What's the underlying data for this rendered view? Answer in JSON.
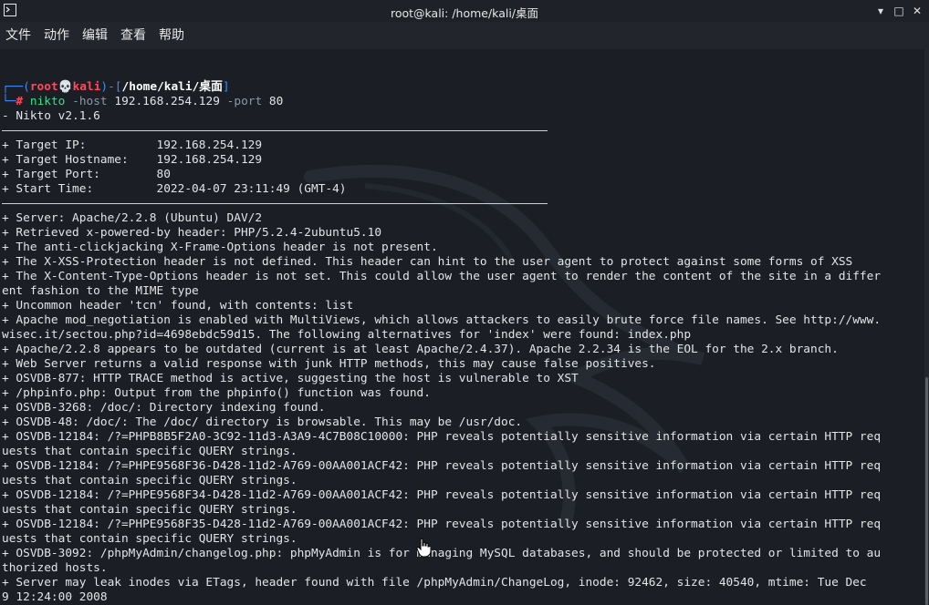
{
  "window": {
    "title": "root@kali: /home/kali/桌面",
    "minimize_glyph": "▾",
    "maximize_glyph": "□",
    "close_glyph": "✕"
  },
  "menu": [
    "文件",
    "动作",
    "编辑",
    "查看",
    "帮助"
  ],
  "prompt": {
    "open_deco": "┌──(",
    "user": "root",
    "skull": "💀",
    "host": "kali",
    "mid_deco": ")-[",
    "path": "/home/kali/桌面",
    "close_deco": "]",
    "second_deco": "└─",
    "hash": "#",
    "cmd": "nikto",
    "flag_host": "-host",
    "ip": "192.168.254.129",
    "flag_port": "-port",
    "port": "80"
  },
  "output": [
    "- Nikto v2.1.6",
    "+ Target IP:          192.168.254.129",
    "+ Target Hostname:    192.168.254.129",
    "+ Target Port:        80",
    "+ Start Time:         2022-04-07 23:11:49 (GMT-4)",
    "+ Server: Apache/2.2.8 (Ubuntu) DAV/2",
    "+ Retrieved x-powered-by header: PHP/5.2.4-2ubuntu5.10",
    "+ The anti-clickjacking X-Frame-Options header is not present.",
    "+ The X-XSS-Protection header is not defined. This header can hint to the user agent to protect against some forms of XSS",
    "+ The X-Content-Type-Options header is not set. This could allow the user agent to render the content of the site in a differ",
    "ent fashion to the MIME type",
    "+ Uncommon header 'tcn' found, with contents: list",
    "+ Apache mod_negotiation is enabled with MultiViews, which allows attackers to easily brute force file names. See http://www.",
    "wisec.it/sectou.php?id=4698ebdc59d15. The following alternatives for 'index' were found: index.php",
    "+ Apache/2.2.8 appears to be outdated (current is at least Apache/2.4.37). Apache 2.2.34 is the EOL for the 2.x branch.",
    "+ Web Server returns a valid response with junk HTTP methods, this may cause false positives.",
    "+ OSVDB-877: HTTP TRACE method is active, suggesting the host is vulnerable to XST",
    "+ /phpinfo.php: Output from the phpinfo() function was found.",
    "+ OSVDB-3268: /doc/: Directory indexing found.",
    "+ OSVDB-48: /doc/: The /doc/ directory is browsable. This may be /usr/doc.",
    "+ OSVDB-12184: /?=PHPB8B5F2A0-3C92-11d3-A3A9-4C7B08C10000: PHP reveals potentially sensitive information via certain HTTP req",
    "uests that contain specific QUERY strings.",
    "+ OSVDB-12184: /?=PHPE9568F36-D428-11d2-A769-00AA001ACF42: PHP reveals potentially sensitive information via certain HTTP req",
    "uests that contain specific QUERY strings.",
    "+ OSVDB-12184: /?=PHPE9568F34-D428-11d2-A769-00AA001ACF42: PHP reveals potentially sensitive information via certain HTTP req",
    "uests that contain specific QUERY strings.",
    "+ OSVDB-12184: /?=PHPE9568F35-D428-11d2-A769-00AA001ACF42: PHP reveals potentially sensitive information via certain HTTP req",
    "uests that contain specific QUERY strings.",
    "+ OSVDB-3092: /phpMyAdmin/changelog.php: phpMyAdmin is for managing MySQL databases, and should be protected or limited to au",
    "thorized hosts.",
    "+ Server may leak inodes via ETags, header found with file /phpMyAdmin/ChangeLog, inode: 92462, size: 40540, mtime: Tue Dec",
    "9 12:24:00 2008"
  ],
  "colors": {
    "background": "#1b1e25",
    "prompt_blue": "#3b8ff5",
    "prompt_red": "#ff4a5c",
    "command_green": "#3edc8a",
    "text": "#e3e4e6"
  }
}
